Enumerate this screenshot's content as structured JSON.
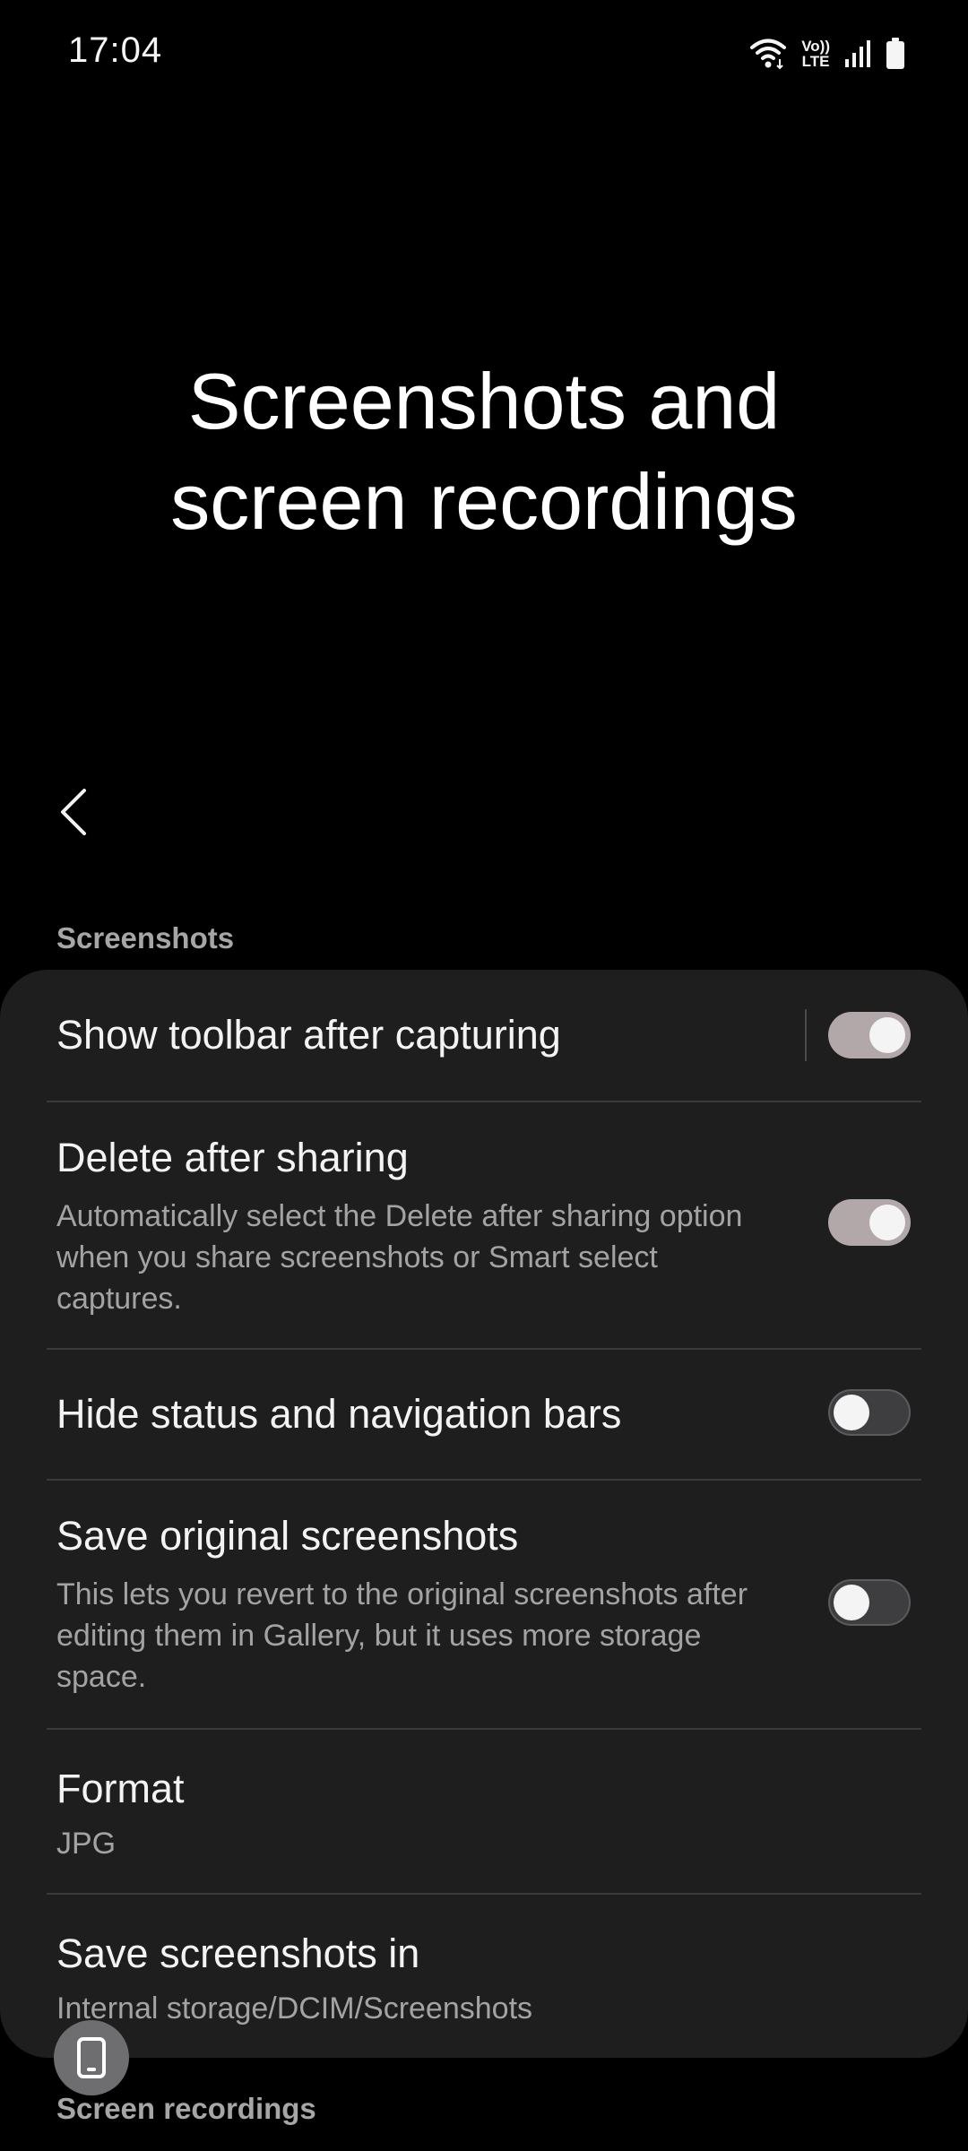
{
  "status_bar": {
    "time": "17:04",
    "volte_top": "Vo))",
    "volte_bottom": "LTE",
    "icons": [
      "wifi-icon",
      "volte-icon",
      "signal-icon",
      "battery-icon"
    ]
  },
  "header": {
    "title_line1": "Screenshots and",
    "title_line2": "screen recordings",
    "back_icon": "chevron-left-icon"
  },
  "sections": {
    "screenshots_label": "Screenshots",
    "screen_recordings_label": "Screen recordings"
  },
  "settings": [
    {
      "title": "Show toolbar after capturing",
      "subtitle": "",
      "toggle": true
    },
    {
      "title": "Delete after sharing",
      "subtitle": "Automatically select the Delete after sharing option when you share screenshots or Smart select captures.",
      "toggle": true
    },
    {
      "title": "Hide status and navigation bars",
      "subtitle": "",
      "toggle": false
    },
    {
      "title": "Save original screenshots",
      "subtitle": "This lets you revert to the original screenshots after editing them in Gallery, but it uses more storage space.",
      "toggle": false
    },
    {
      "title": "Format",
      "subtitle": "JPG"
    },
    {
      "title": "Save screenshots in",
      "subtitle": "Internal storage/DCIM/Screenshots"
    }
  ],
  "colors": {
    "background": "#000000",
    "card": "#1e1e1f",
    "toggle_on": "#b2a8aa",
    "toggle_off": "#3e3e40",
    "secondary_text": "#a3a3a3"
  },
  "floating_button_icon": "phone-icon"
}
